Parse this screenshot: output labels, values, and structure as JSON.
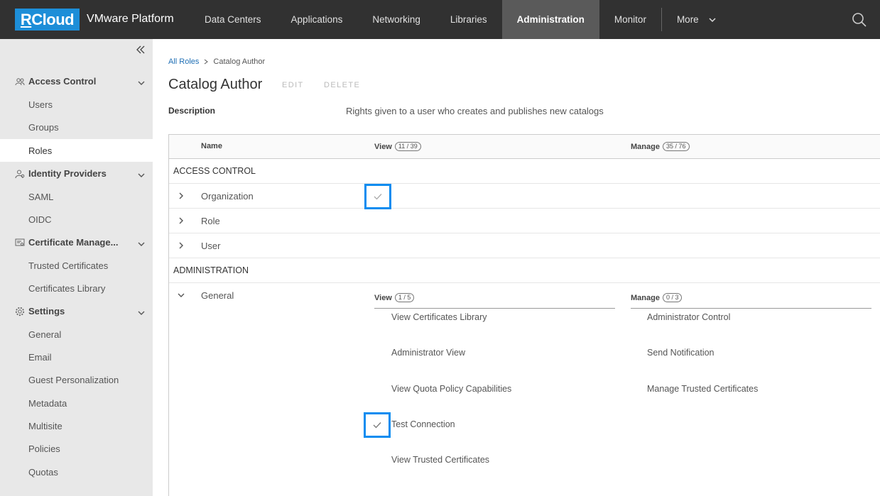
{
  "header": {
    "logo": {
      "r": "R",
      "rest": "Cloud"
    },
    "app_title": "VMware Platform",
    "nav": [
      {
        "label": "Data Centers",
        "active": false
      },
      {
        "label": "Applications",
        "active": false
      },
      {
        "label": "Networking",
        "active": false
      },
      {
        "label": "Libraries",
        "active": false
      },
      {
        "label": "Administration",
        "active": true
      },
      {
        "label": "Monitor",
        "active": false
      }
    ],
    "more_label": "More",
    "search_icon": "search-icon"
  },
  "sidebar": {
    "groups": [
      {
        "label": "Access Control",
        "icon": "users-icon",
        "items": [
          "Users",
          "Groups",
          "Roles"
        ]
      },
      {
        "label": "Identity Providers",
        "icon": "identity-icon",
        "items": [
          "SAML",
          "OIDC"
        ]
      },
      {
        "label": "Certificate Manage...",
        "icon": "certificate-icon",
        "items": [
          "Trusted Certificates",
          "Certificates Library"
        ]
      },
      {
        "label": "Settings",
        "icon": "gear-icon",
        "items": [
          "General",
          "Email",
          "Guest Personalization",
          "Metadata",
          "Multisite",
          "Policies",
          "Quotas"
        ]
      }
    ],
    "active_item": "Roles"
  },
  "main": {
    "breadcrumb": {
      "root": "All Roles",
      "current": "Catalog Author"
    },
    "title": "Catalog Author",
    "edit_label": "EDIT",
    "delete_label": "DELETE",
    "description_label": "Description",
    "description_value": "Rights given to a user who creates and publishes new catalogs",
    "grid": {
      "col_name": "Name",
      "col_view": "View",
      "col_view_count": "11 / 39",
      "col_manage": "Manage",
      "col_manage_count": "35 / 76",
      "sections": [
        {
          "title": "ACCESS CONTROL",
          "rows": [
            "Organization",
            "Role",
            "User"
          ]
        },
        {
          "title": "ADMINISTRATION",
          "rows": [
            "General"
          ]
        }
      ],
      "general": {
        "view_label": "View",
        "view_count": "1 / 5",
        "manage_label": "Manage",
        "manage_count": "0 / 3",
        "view_rights": [
          "View Certificates Library",
          "Administrator View",
          "View Quota Policy Capabilities",
          "Test Connection",
          "View Trusted Certificates"
        ],
        "manage_rights": [
          "Administrator Control",
          "Send Notification",
          "Manage Trusted Certificates"
        ]
      }
    }
  },
  "colors": {
    "header_bg": "#313131",
    "accent": "#1d8ed8",
    "highlight": "#0a8cf0",
    "sidebar_bg": "#e8e8e8"
  }
}
